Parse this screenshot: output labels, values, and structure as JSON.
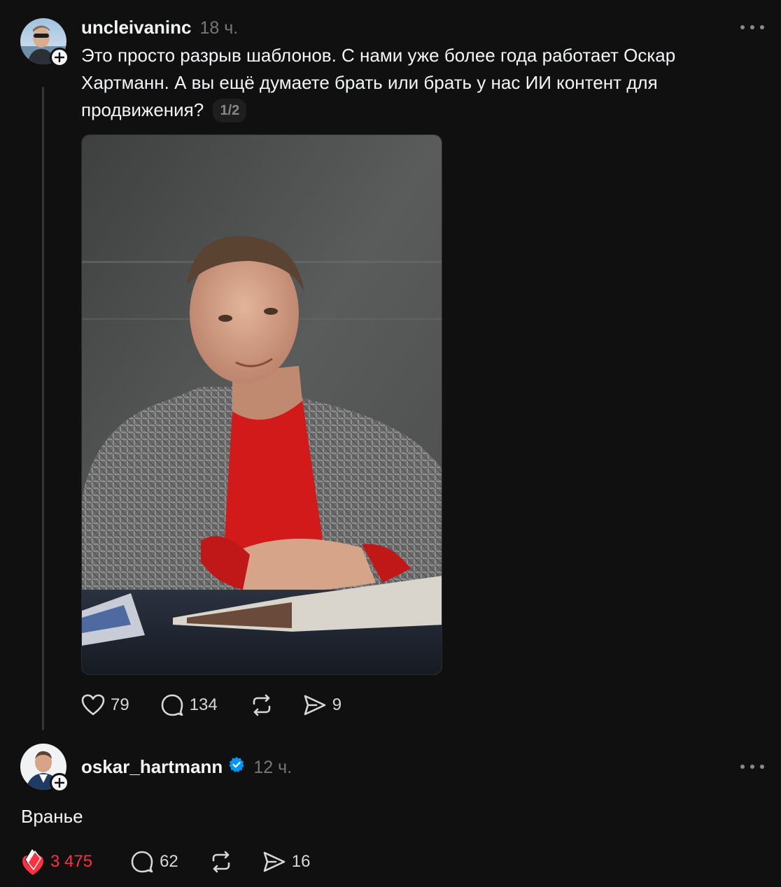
{
  "posts": [
    {
      "username": "uncleivaninc",
      "time": "18 ч.",
      "text": "Это просто разрыв шаблонов. С нами уже более года работает Оскар Хартманн. А вы ещё думаете брать или брать у нас ИИ контент для продвижения?",
      "pager": "1/2",
      "likes": "79",
      "comments": "134",
      "shares": "9",
      "avatar_icon": "user-avatar",
      "media": "photo-man-red-sweater"
    },
    {
      "username": "oskar_hartmann",
      "verified": true,
      "time": "12 ч.",
      "text": "Вранье",
      "likes": "3 475",
      "comments": "62",
      "shares": "16",
      "liked": true,
      "like_color": "#ff3040",
      "avatar_icon": "user-avatar"
    }
  ],
  "colors": {
    "background": "#101010",
    "verified": "#0095f6",
    "like_active": "#ff3040"
  }
}
